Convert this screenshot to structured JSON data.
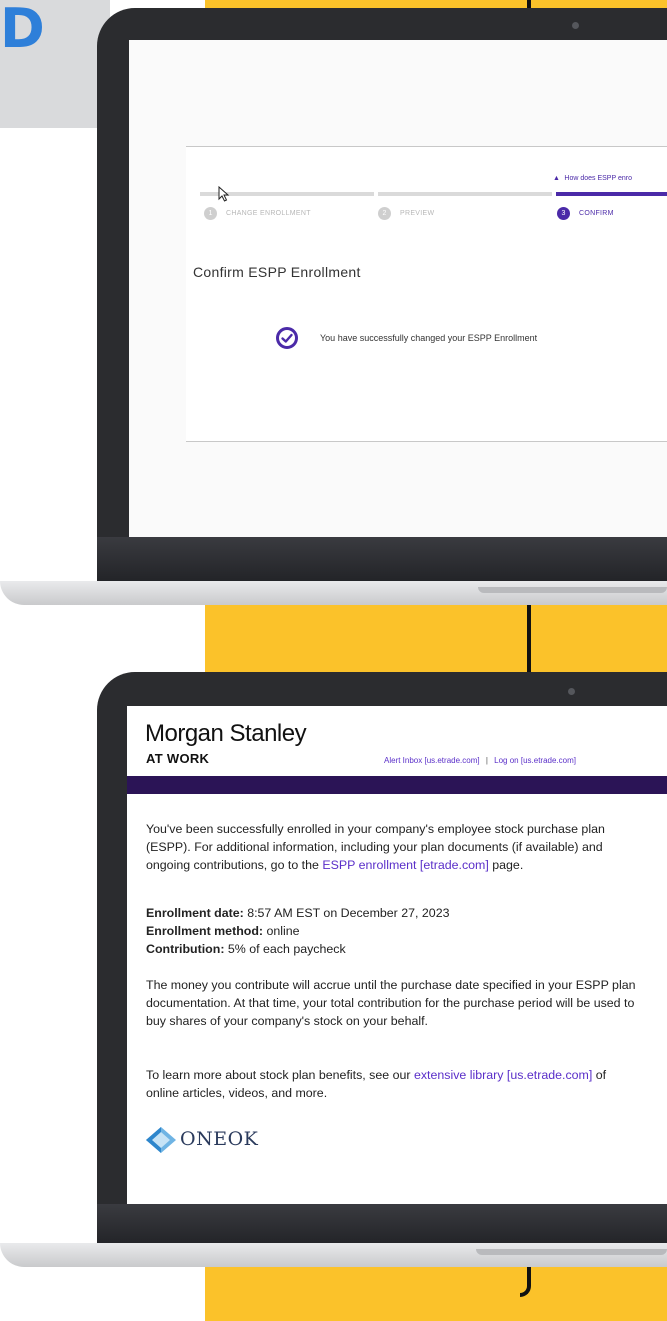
{
  "badge": {
    "letter": "D"
  },
  "confirm_screen": {
    "help_link": "How does ESPP enro",
    "steps": [
      {
        "num": "1",
        "label": "CHANGE ENROLLMENT",
        "active": false
      },
      {
        "num": "2",
        "label": "PREVIEW",
        "active": false
      },
      {
        "num": "3",
        "label": "CONFIRM",
        "active": true
      }
    ],
    "title": "Confirm ESPP Enrollment",
    "success_message": "You have successfully changed your ESPP Enrollment"
  },
  "email": {
    "brand_name": "Morgan Stanley",
    "brand_sub": "AT WORK",
    "alert_inbox_link": "Alert Inbox [us.etrade.com]",
    "separator": "|",
    "logon_link": "Log on [us.etrade.com]",
    "para1_text": "You've been successfully enrolled in your company's employee stock purchase plan (ESPP). For additional information, including your plan documents (if available) and ongoing contributions, go to the ",
    "para1_link": "ESPP enrollment [etrade.com]",
    "para1_end": " page.",
    "enrollment_date_label": "Enrollment date:",
    "enrollment_date_value": " 8:57 AM EST on December 27, 2023",
    "enrollment_method_label": "Enrollment method:",
    "enrollment_method_value": " online",
    "contribution_label": "Contribution:",
    "contribution_value": " 5% of each paycheck",
    "para3": "The money you contribute will accrue until the purchase date specified in your ESPP plan documentation. At that time, your total contribution for the purchase period will be used to buy shares of your company's stock on your behalf.",
    "para4_text": "To learn more about stock plan benefits, see our ",
    "para4_link": "extensive library [us.etrade.com]",
    "para4_end": " of online articles, videos, and more.",
    "company_logo_text": "ONEOK"
  },
  "colors": {
    "accent": "#4b2aa8",
    "band": "#2b1456",
    "yellow": "#fbc22a",
    "badge": "#2e7fd9"
  }
}
